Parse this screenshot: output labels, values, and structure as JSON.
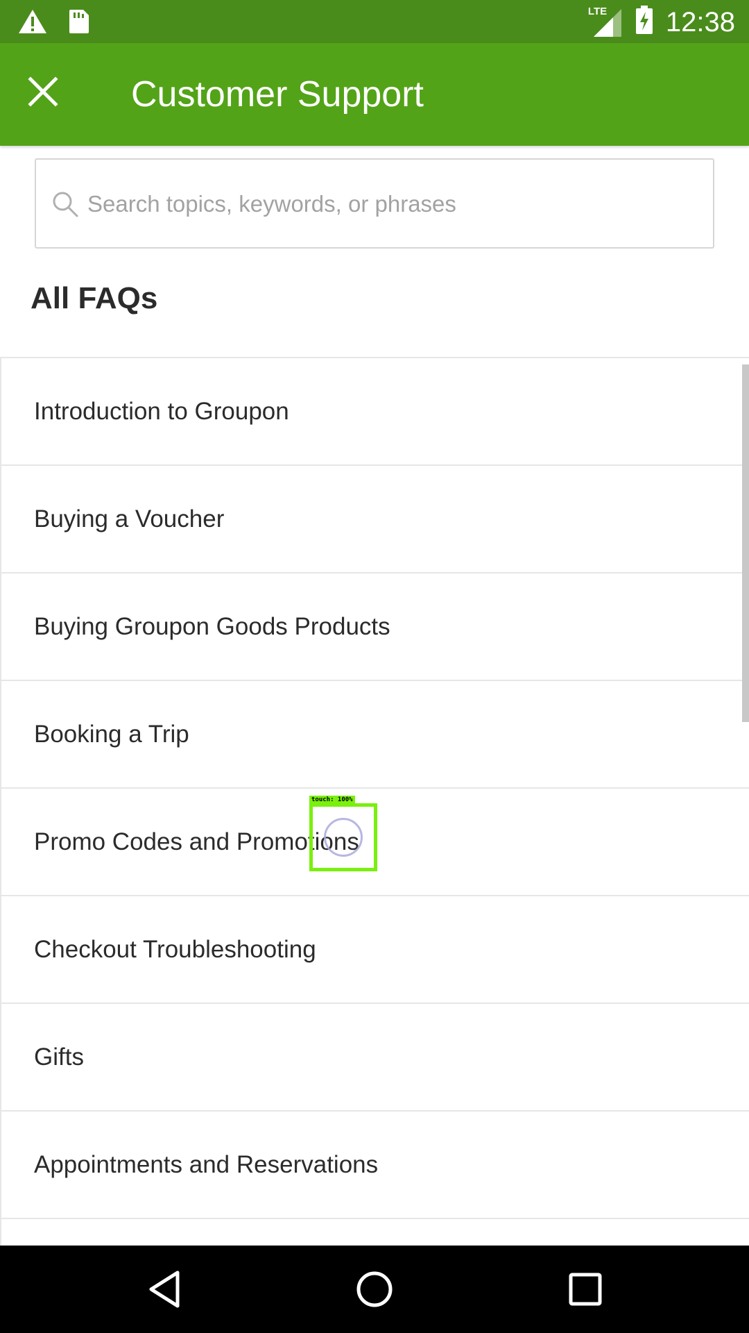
{
  "status_bar": {
    "time": "12:38",
    "network_label": "LTE",
    "left_icons": [
      "warning-icon",
      "sd-card-icon"
    ],
    "right_icons": [
      "signal-icon",
      "battery-charging-icon"
    ]
  },
  "app_bar": {
    "title": "Customer Support",
    "close_icon": "close-icon",
    "background": "#53a318"
  },
  "search": {
    "placeholder": "Search topics, keywords, or phrases",
    "value": ""
  },
  "section": {
    "title": "All FAQs"
  },
  "faq_items": [
    "Introduction to Groupon",
    "Buying a Voucher",
    "Buying Groupon Goods Products",
    "Booking a Trip",
    "Promo Codes and Promotions",
    "Checkout Troubleshooting",
    "Gifts",
    "Appointments and Reservations",
    ""
  ],
  "touch_indicator": {
    "label": "touch: 100%"
  },
  "nav_bar": {
    "buttons": [
      "back-icon",
      "home-icon",
      "recents-icon"
    ]
  }
}
